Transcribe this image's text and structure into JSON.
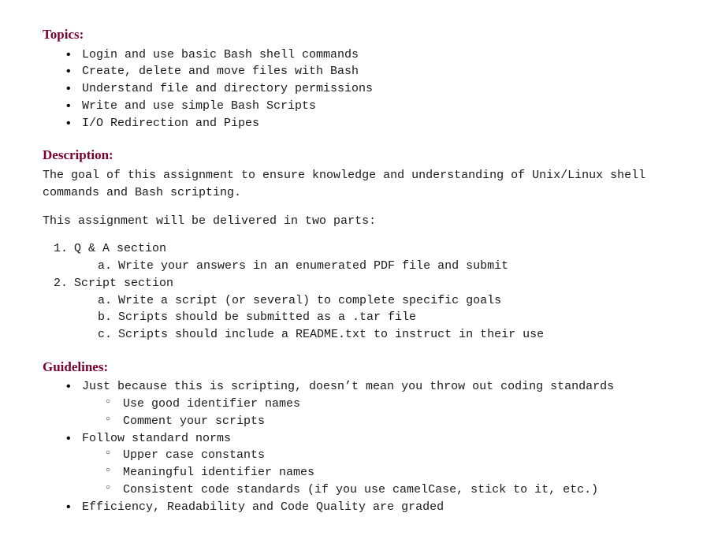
{
  "topics": {
    "heading": "Topics:",
    "items": [
      "Login and use basic Bash shell commands",
      "Create, delete and move files with Bash",
      "Understand file and directory permissions",
      "Write and use simple Bash Scripts",
      "I/O Redirection and Pipes"
    ]
  },
  "description": {
    "heading": "Description:",
    "para1": "The goal of this assignment to ensure knowledge and understanding of Unix/Linux shell commands and Bash scripting.",
    "para2": "This assignment will be delivered in two parts:",
    "parts": [
      {
        "label": "Q & A section",
        "sub": [
          "Write your answers in an enumerated PDF file and submit"
        ]
      },
      {
        "label": "Script section",
        "sub": [
          "Write a script (or several) to complete specific goals",
          "Scripts should be submitted as a .tar file",
          "Scripts should include a README.txt to instruct in their use"
        ]
      }
    ]
  },
  "guidelines": {
    "heading": "Guidelines:",
    "items": [
      {
        "text": "Just because this is scripting, doesn’t mean you throw out coding standards",
        "sub": [
          "Use good identifier names",
          "Comment your scripts"
        ]
      },
      {
        "text": "Follow standard norms",
        "sub": [
          "Upper case constants",
          "Meaningful identifier names",
          "Consistent code standards (if you use camelCase, stick to it, etc.)"
        ]
      },
      {
        "text": "Efficiency, Readability and Code Quality are graded",
        "sub": []
      }
    ]
  }
}
